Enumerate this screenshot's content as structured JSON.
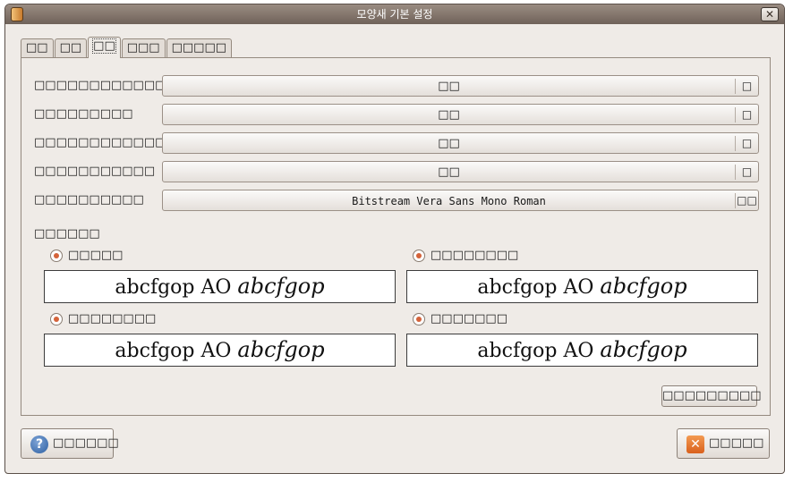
{
  "window": {
    "title": "모양새 기본 설정",
    "close_glyph": "✕"
  },
  "tabs": [
    "□□",
    "□□",
    "□□",
    "□□□",
    "□□□□□"
  ],
  "font_rows": [
    {
      "label": "□□□□□□□□□□□□□",
      "value": "□□",
      "size": "□"
    },
    {
      "label": "□□□□□□□□□",
      "value": "□□",
      "size": "□"
    },
    {
      "label": "□□□□□□□□□□□□",
      "value": "□□",
      "size": "□"
    },
    {
      "label": "□□□□□□□□□□□",
      "value": "□□",
      "size": "□"
    },
    {
      "label": "□□□□□□□□□□",
      "value": "Bitstream Vera Sans Mono Roman",
      "size": "□□"
    }
  ],
  "rendering": {
    "title": "□□□□□□",
    "options": [
      {
        "label": "□□□□□",
        "selected": true
      },
      {
        "label": "□□□□□□□□",
        "selected": true
      },
      {
        "label": "□□□□□□□□",
        "selected": true
      },
      {
        "label": "□□□□□□□",
        "selected": true
      }
    ],
    "preview_plain": "abcfgop AO ",
    "preview_italic": "abcfgop"
  },
  "buttons": {
    "details": "□□□□□□□□□",
    "help": "□□□□□□",
    "close": "□□□□□"
  },
  "icons": {
    "help": "?",
    "close": "✕"
  }
}
